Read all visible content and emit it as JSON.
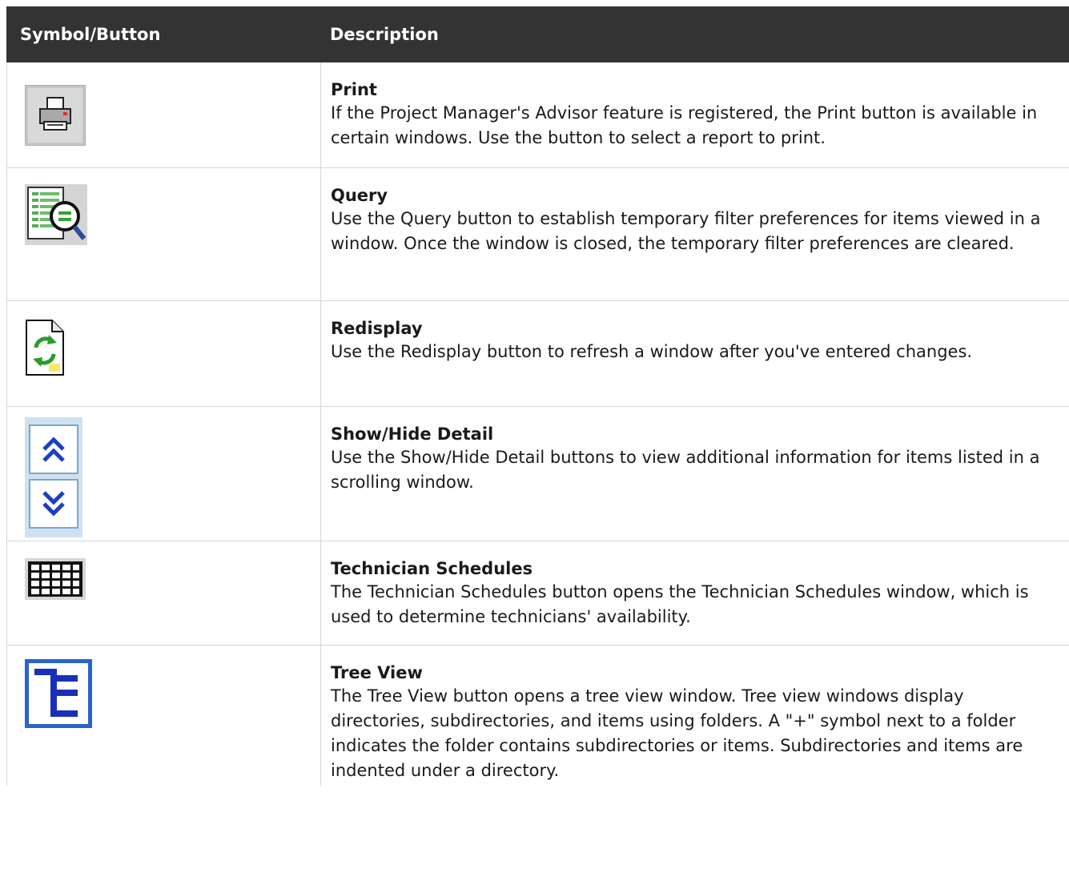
{
  "header": {
    "symbol_col": "Symbol/Button",
    "desc_col": "Description"
  },
  "rows": [
    {
      "icon": "print-icon",
      "title": "Print",
      "description": "If the Project Manager's Advisor feature is registered, the Print button is available in certain windows. Use the button to select a report to print."
    },
    {
      "icon": "query-icon",
      "title": "Query",
      "description": "Use the Query button to establish temporary filter preferences for items viewed in a window. Once the window is closed, the temporary filter preferences are cleared."
    },
    {
      "icon": "redisplay-icon",
      "title": "Redisplay",
      "description": "Use the Redisplay button to refresh a window after you've entered changes."
    },
    {
      "icon": "show-hide-detail-icon",
      "title": "Show/Hide Detail",
      "description": "Use the Show/Hide Detail buttons to view additional information for items listed in a scrolling window."
    },
    {
      "icon": "technician-schedules-icon",
      "title": "Technician Schedules",
      "description": "The Technician Schedules button opens the Technician Schedules window, which is used to determine technicians' availability."
    },
    {
      "icon": "tree-view-icon",
      "title": "Tree View",
      "description": "The Tree View button opens a tree view window. Tree view windows display directories, subdirectories, and items using folders. A \"+\" symbol next to a folder indicates the folder contains subdirectories or items. Subdirectories and items are indented under a directory."
    }
  ]
}
